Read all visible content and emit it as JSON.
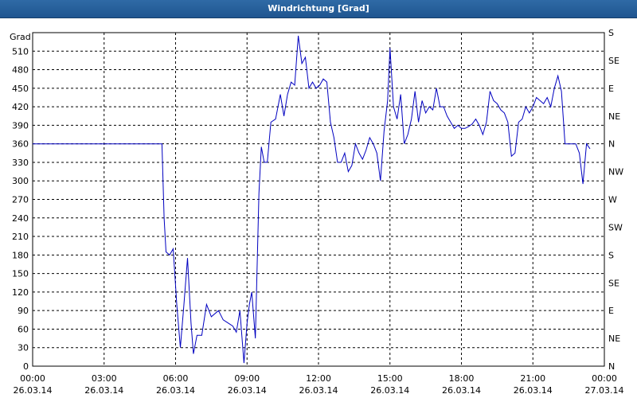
{
  "window": {
    "title": "Windrichtung [Grad]"
  },
  "chart_data": {
    "type": "line",
    "title": "Windrichtung [Grad]",
    "ylabel": "Grad",
    "xlabel": "",
    "ylim": [
      0,
      540
    ],
    "xlim_hours": [
      0,
      24
    ],
    "grid": true,
    "line_color": "#0000c0",
    "y_ticks": [
      0,
      30,
      60,
      90,
      120,
      150,
      180,
      210,
      240,
      270,
      300,
      330,
      360,
      390,
      420,
      450,
      480,
      510
    ],
    "right_axis": {
      "labels": [
        {
          "value": 0,
          "label": "N"
        },
        {
          "value": 45,
          "label": "NE"
        },
        {
          "value": 90,
          "label": "E"
        },
        {
          "value": 135,
          "label": "SE"
        },
        {
          "value": 180,
          "label": "S"
        },
        {
          "value": 225,
          "label": "SW"
        },
        {
          "value": 270,
          "label": "W"
        },
        {
          "value": 315,
          "label": "NW"
        },
        {
          "value": 360,
          "label": "N"
        },
        {
          "value": 405,
          "label": "NE"
        },
        {
          "value": 450,
          "label": "E"
        },
        {
          "value": 495,
          "label": "SE"
        },
        {
          "value": 540,
          "label": "S"
        }
      ]
    },
    "x_ticks": [
      {
        "time": "00:00",
        "date": "26.03.14"
      },
      {
        "time": "03:00",
        "date": "26.03.14"
      },
      {
        "time": "06:00",
        "date": "26.03.14"
      },
      {
        "time": "09:00",
        "date": "26.03.14"
      },
      {
        "time": "12:00",
        "date": "26.03.14"
      },
      {
        "time": "15:00",
        "date": "26.03.14"
      },
      {
        "time": "18:00",
        "date": "26.03.14"
      },
      {
        "time": "21:00",
        "date": "26.03.14"
      },
      {
        "time": "00:00",
        "date": "27.03.14"
      }
    ],
    "series": [
      {
        "points": [
          [
            0.0,
            360
          ],
          [
            5.43,
            360
          ],
          [
            5.52,
            240
          ],
          [
            5.6,
            185
          ],
          [
            5.75,
            180
          ],
          [
            5.9,
            190
          ],
          [
            6.05,
            100
          ],
          [
            6.2,
            30
          ],
          [
            6.35,
            100
          ],
          [
            6.5,
            175
          ],
          [
            6.65,
            70
          ],
          [
            6.75,
            20
          ],
          [
            6.9,
            50
          ],
          [
            7.1,
            50
          ],
          [
            7.3,
            100
          ],
          [
            7.5,
            80
          ],
          [
            7.8,
            90
          ],
          [
            8.0,
            75
          ],
          [
            8.2,
            70
          ],
          [
            8.4,
            65
          ],
          [
            8.55,
            55
          ],
          [
            8.7,
            90
          ],
          [
            8.8,
            40
          ],
          [
            8.87,
            5
          ],
          [
            9.0,
            70
          ],
          [
            9.1,
            100
          ],
          [
            9.2,
            120
          ],
          [
            9.35,
            45
          ],
          [
            9.5,
            280
          ],
          [
            9.6,
            355
          ],
          [
            9.72,
            330
          ],
          [
            9.85,
            330
          ],
          [
            10.0,
            395
          ],
          [
            10.2,
            400
          ],
          [
            10.4,
            440
          ],
          [
            10.55,
            405
          ],
          [
            10.7,
            440
          ],
          [
            10.85,
            460
          ],
          [
            11.0,
            455
          ],
          [
            11.15,
            535
          ],
          [
            11.3,
            490
          ],
          [
            11.45,
            500
          ],
          [
            11.6,
            450
          ],
          [
            11.75,
            460
          ],
          [
            11.9,
            450
          ],
          [
            12.05,
            455
          ],
          [
            12.2,
            465
          ],
          [
            12.35,
            460
          ],
          [
            12.5,
            395
          ],
          [
            12.65,
            370
          ],
          [
            12.8,
            330
          ],
          [
            12.95,
            330
          ],
          [
            13.1,
            345
          ],
          [
            13.25,
            315
          ],
          [
            13.4,
            325
          ],
          [
            13.55,
            360
          ],
          [
            13.7,
            345
          ],
          [
            13.85,
            335
          ],
          [
            14.0,
            350
          ],
          [
            14.15,
            370
          ],
          [
            14.3,
            360
          ],
          [
            14.45,
            345
          ],
          [
            14.6,
            300
          ],
          [
            14.75,
            380
          ],
          [
            14.9,
            430
          ],
          [
            15.0,
            515
          ],
          [
            15.15,
            420
          ],
          [
            15.3,
            400
          ],
          [
            15.45,
            440
          ],
          [
            15.6,
            360
          ],
          [
            15.75,
            375
          ],
          [
            15.9,
            400
          ],
          [
            16.05,
            445
          ],
          [
            16.2,
            395
          ],
          [
            16.35,
            430
          ],
          [
            16.5,
            410
          ],
          [
            16.65,
            420
          ],
          [
            16.8,
            415
          ],
          [
            16.95,
            450
          ],
          [
            17.1,
            420
          ],
          [
            17.25,
            420
          ],
          [
            17.4,
            405
          ],
          [
            17.55,
            395
          ],
          [
            17.7,
            385
          ],
          [
            17.85,
            390
          ],
          [
            18.0,
            385
          ],
          [
            18.15,
            385
          ],
          [
            18.3,
            388
          ],
          [
            18.45,
            392
          ],
          [
            18.6,
            400
          ],
          [
            18.75,
            390
          ],
          [
            18.9,
            375
          ],
          [
            19.05,
            395
          ],
          [
            19.2,
            445
          ],
          [
            19.35,
            430
          ],
          [
            19.5,
            425
          ],
          [
            19.65,
            415
          ],
          [
            19.8,
            410
          ],
          [
            19.95,
            395
          ],
          [
            20.1,
            340
          ],
          [
            20.25,
            345
          ],
          [
            20.4,
            395
          ],
          [
            20.55,
            400
          ],
          [
            20.7,
            420
          ],
          [
            20.85,
            410
          ],
          [
            21.0,
            420
          ],
          [
            21.15,
            435
          ],
          [
            21.3,
            430
          ],
          [
            21.45,
            425
          ],
          [
            21.6,
            435
          ],
          [
            21.75,
            420
          ],
          [
            21.9,
            450
          ],
          [
            22.05,
            470
          ],
          [
            22.2,
            445
          ],
          [
            22.35,
            360
          ],
          [
            22.5,
            360
          ],
          [
            22.65,
            360
          ],
          [
            22.8,
            360
          ],
          [
            22.95,
            345
          ],
          [
            23.1,
            295
          ],
          [
            23.25,
            360
          ],
          [
            23.4,
            352
          ]
        ]
      }
    ]
  }
}
